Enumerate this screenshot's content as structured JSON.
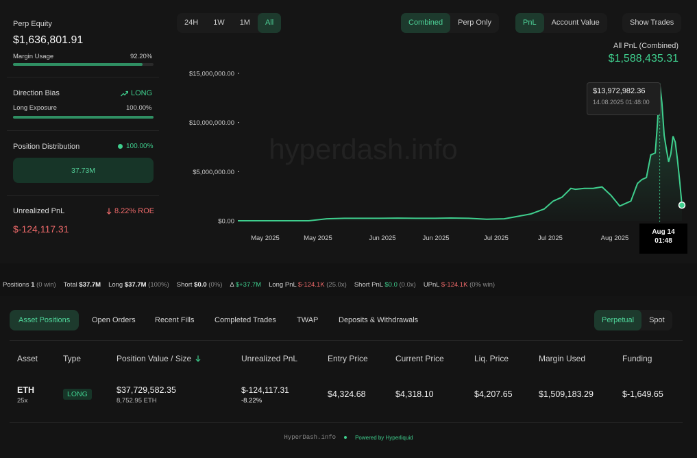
{
  "summary": {
    "perp_equity_label": "Perp Equity",
    "perp_equity_value": "$1,636,801.91",
    "margin_usage_label": "Margin Usage",
    "margin_usage_value": "92.20%",
    "margin_usage_fraction": 0.922,
    "direction_bias_label": "Direction Bias",
    "direction_bias_value": "LONG",
    "long_exposure_label": "Long Exposure",
    "long_exposure_value": "100.00%",
    "long_exposure_fraction": 1.0,
    "position_distribution_label": "Position Distribution",
    "position_distribution_value": "100.00%",
    "position_distribution_amount": "37.73M",
    "unrealized_pnl_label": "Unrealized PnL",
    "unrealized_pnl_roe": "8.22% ROE",
    "unrealized_pnl_value": "$-124,117.31"
  },
  "timeframe_tabs": [
    "24H",
    "1W",
    "1M",
    "All"
  ],
  "timeframe_active": "All",
  "mode_tabs": [
    "Combined",
    "Perp Only"
  ],
  "mode_active": "Combined",
  "metric_tabs": [
    "PnL",
    "Account Value"
  ],
  "metric_active": "PnL",
  "show_trades_label": "Show Trades",
  "chart_header": {
    "label": "All PnL (Combined)",
    "value": "$1,588,435.31"
  },
  "watermark": "hyperdash.info",
  "tooltip": {
    "value": "$13,972,982.36",
    "date": "14.08.2025 01:48:00",
    "x_label_line1": "Aug 14",
    "x_label_line2": "01:48"
  },
  "chart_data": {
    "type": "area",
    "ylim": [
      0,
      15000000
    ],
    "y_ticks": [
      "$15,000,000.00",
      "$10,000,000.00",
      "$5,000,000.00",
      "$0.00"
    ],
    "y_tick_values": [
      15000000,
      10000000,
      5000000,
      0
    ],
    "x_tick_labels": [
      "May 2025",
      "May 2025",
      "Jun 2025",
      "Jun 2025",
      "Jul 2025",
      "Jul 2025",
      "Aug 2025"
    ],
    "x": [
      0,
      0.04,
      0.08,
      0.12,
      0.16,
      0.2,
      0.24,
      0.28,
      0.32,
      0.36,
      0.4,
      0.44,
      0.48,
      0.52,
      0.56,
      0.6,
      0.63,
      0.66,
      0.69,
      0.71,
      0.73,
      0.75,
      0.76,
      0.78,
      0.8,
      0.82,
      0.84,
      0.86,
      0.87,
      0.885,
      0.9,
      0.91,
      0.92,
      0.93,
      0.94,
      0.945,
      0.95,
      0.955,
      0.96,
      0.965,
      0.97,
      0.975,
      0.98,
      0.985,
      0.99,
      0.995,
      1.0
    ],
    "values": [
      0,
      0,
      0,
      0,
      0,
      200000,
      250000,
      250000,
      250000,
      270000,
      250000,
      250000,
      280000,
      250000,
      150000,
      200000,
      450000,
      700000,
      1200000,
      2000000,
      2400000,
      3300000,
      3200000,
      3300000,
      3300000,
      3450000,
      2600000,
      1500000,
      1700000,
      2000000,
      3800000,
      4200000,
      4400000,
      6700000,
      6900000,
      10000000,
      13972982,
      12000000,
      8700000,
      7300000,
      6000000,
      6800000,
      8600000,
      8000000,
      6200000,
      4000000,
      1588435
    ],
    "series_color": "#3fcf8e",
    "grid": false
  },
  "stats": {
    "positions_label": "Positions",
    "positions_value": "1",
    "positions_win": "(0 win)",
    "total_label": "Total",
    "total_value": "$37.7M",
    "long_label": "Long",
    "long_value": "$37.7M",
    "long_pct": "(100%)",
    "short_label": "Short",
    "short_value": "$0.0",
    "short_pct": "(0%)",
    "delta_label": "Δ",
    "delta_value": "$+37.7M",
    "long_pnl_label": "Long PnL",
    "long_pnl_value": "$-124.1K",
    "long_pnl_x": "(25.0x)",
    "short_pnl_label": "Short PnL",
    "short_pnl_value": "$0.0",
    "short_pnl_x": "(0.0x)",
    "upnl_label": "UPnL",
    "upnl_value": "$-124.1K",
    "upnl_win": "(0% win)"
  },
  "bottom_tabs": [
    "Asset Positions",
    "Open Orders",
    "Recent Fills",
    "Completed Trades",
    "TWAP",
    "Deposits & Withdrawals"
  ],
  "bottom_tab_active": "Asset Positions",
  "market_tabs": [
    "Perpetual",
    "Spot"
  ],
  "market_tab_active": "Perpetual",
  "table": {
    "headers": [
      "Asset",
      "Type",
      "Position Value / Size",
      "Unrealized PnL",
      "Entry Price",
      "Current Price",
      "Liq. Price",
      "Margin Used",
      "Funding"
    ],
    "row": {
      "asset": "ETH",
      "leverage": "25x",
      "type": "LONG",
      "position_value": "$37,729,582.35",
      "position_size": "8,752.95 ETH",
      "unrealized_pnl": "$-124,117.31",
      "unrealized_pnl_pct": "-8.22%",
      "entry_price": "$4,324.68",
      "current_price": "$4,318.10",
      "liq_price": "$4,207.65",
      "margin_used": "$1,509,183.29",
      "funding": "$-1,649.65"
    }
  },
  "footer": {
    "site": "HyperDash.info",
    "powered": "Powered by Hyperliquid"
  }
}
